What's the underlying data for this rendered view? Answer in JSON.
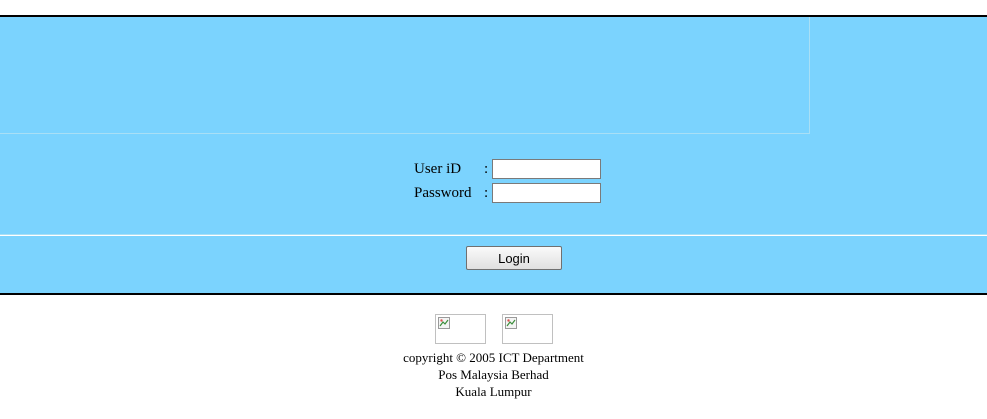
{
  "login_form": {
    "user_id_label": "User iD",
    "password_label": "Password",
    "separator": ":",
    "user_id_value": "",
    "password_value": "",
    "login_button_label": "Login"
  },
  "footer": {
    "copyright": "copyright © 2005 ICT Department",
    "company": "Pos Malaysia Berhad",
    "location": "Kuala Lumpur"
  },
  "footer_images": [
    {
      "icon": "broken-image-icon"
    },
    {
      "icon": "broken-image-icon"
    }
  ],
  "colors": {
    "panel_background": "#7bd3fe",
    "panel_border": "#000000",
    "page_background": "#ffffff"
  }
}
